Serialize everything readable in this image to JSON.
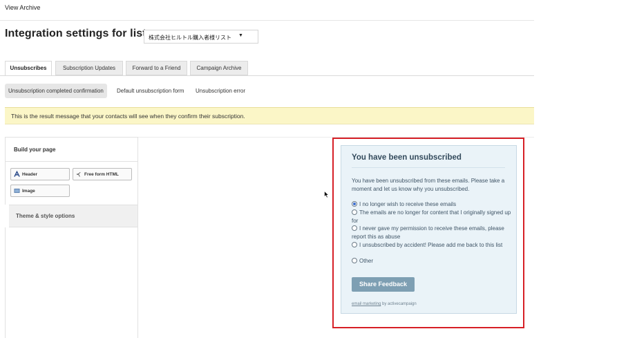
{
  "header": {
    "view_archive": "View Archive",
    "page_title": "Integration settings for list",
    "list_select_value": "株式会社ヒルトル購入者様リスト"
  },
  "tabs": [
    {
      "label": "Unsubscribes",
      "active": true
    },
    {
      "label": "Subscription Updates",
      "active": false
    },
    {
      "label": "Forward to a Friend",
      "active": false
    },
    {
      "label": "Campaign Archive",
      "active": false
    }
  ],
  "subtabs": [
    {
      "label": "Unsubscription completed confirmation",
      "active": true
    },
    {
      "label": "Default unsubscription form",
      "active": false
    },
    {
      "label": "Unsubscription error",
      "active": false
    }
  ],
  "notice": "This is the result message that your contacts will see when they confirm their subscription.",
  "builder": {
    "build_title": "Build your page",
    "blocks": [
      {
        "label": "Header",
        "icon": "header-icon"
      },
      {
        "label": "Free form HTML",
        "icon": "code-icon"
      },
      {
        "label": "Image",
        "icon": "image-icon"
      }
    ],
    "theme_options": "Theme & style options"
  },
  "preview": {
    "title": "You have been unsubscribed",
    "intro": "You have been unsubscribed from these emails. Please take a moment and let us know why you unsubscribed.",
    "reasons": [
      {
        "label": "I no longer wish to receive these emails",
        "checked": true
      },
      {
        "label": "The emails are no longer for content that I originally signed up for",
        "checked": false
      },
      {
        "label": "I never gave my permission to receive these emails, please report this as abuse",
        "checked": false
      },
      {
        "label": "I unsubscribed by accident! Please add me back to this list",
        "checked": false
      },
      {
        "label": "Other",
        "checked": false
      }
    ],
    "button": "Share Feedback",
    "credit_link": "email marketing",
    "credit_text": " by activecampaign"
  },
  "colors": {
    "notice_bg": "#fbf6c7",
    "card_bg": "#eaf3f8",
    "highlight_border": "#d61f26",
    "button_bg": "#7e9fb3"
  }
}
